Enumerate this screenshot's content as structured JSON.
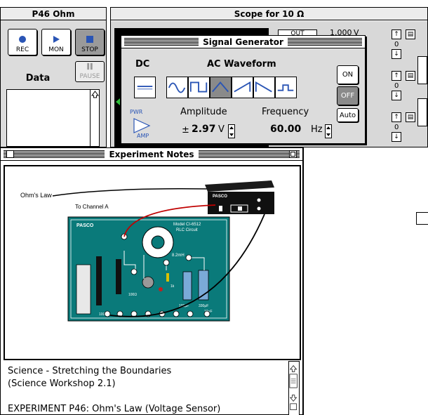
{
  "p46_window": {
    "title": "P46 Ohm",
    "buttons": [
      {
        "label": "REC",
        "icon": "record-icon"
      },
      {
        "label": "MON",
        "icon": "play-icon"
      },
      {
        "label": "STOP",
        "icon": "stop-icon"
      }
    ],
    "pause_label": "PAUSE",
    "data_label": "Data"
  },
  "scope_window": {
    "title": "Scope for 10 Ω",
    "row1": {
      "button_label": "OUT",
      "value": "1.000",
      "unit": "V",
      "offset": "0"
    },
    "row2": {
      "offset": "0"
    },
    "row3": {
      "offset": "0"
    }
  },
  "signal_generator": {
    "title": "Signal Generator",
    "dc_label": "DC",
    "ac_label": "AC Waveform",
    "waveforms": [
      "sine",
      "square",
      "triangle",
      "ramp-up",
      "ramp-down",
      "positive-square"
    ],
    "selected_waveform": "triangle",
    "on_label": "ON",
    "off_label": "OFF",
    "auto_label": "Auto",
    "amp_label_pwr": "PWR",
    "amp_label_amp": "AMP",
    "amplitude_label": "Amplitude",
    "amplitude_sign": "±",
    "amplitude_value": "2.97",
    "amplitude_unit": "V",
    "frequency_label": "Frequency",
    "frequency_value": "60.00",
    "frequency_unit": "Hz"
  },
  "notes_window": {
    "title": "Experiment Notes",
    "diagram": {
      "ohms_law_label": "Ohm's Law",
      "channel_label": "To Channel A",
      "interface_brand": "PASCO",
      "board_brand": "PASCO",
      "board_model_line1": "Model CI-6512",
      "board_model_line2": "RLC Circuit",
      "inductor_label": "8.2mH",
      "resistor_label_100": "100Ω",
      "resistor_label_10": "10Ω",
      "resistor_label_1k": "1k",
      "cap_label_100": "100μF",
      "cap_label_330": "330μF",
      "cap_label_10": "10μF"
    },
    "text_lines": [
      "Science - Stretching the Boundaries",
      "(Science Workshop 2.1)",
      "",
      "EXPERIMENT P46: Ohm's Law (Voltage Sensor)"
    ]
  }
}
